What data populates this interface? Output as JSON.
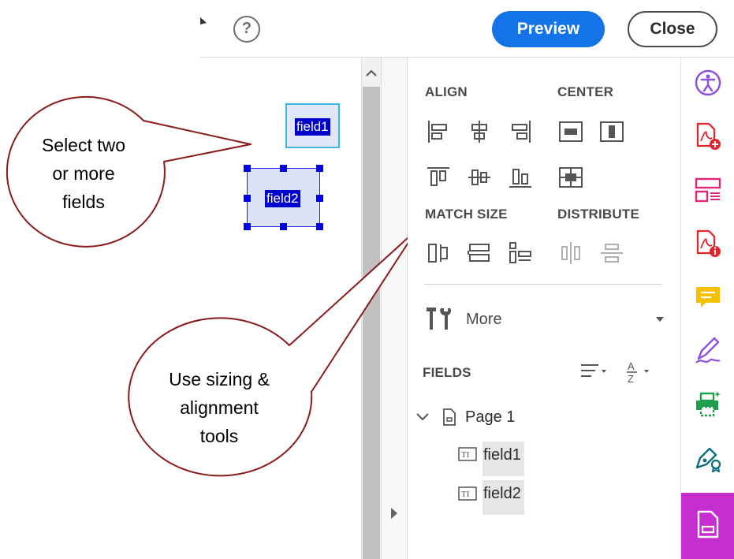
{
  "toolbar": {
    "help_label": "?",
    "preview_label": "Preview",
    "close_label": "Close"
  },
  "document": {
    "fields": [
      {
        "name": "field1",
        "selected": false
      },
      {
        "name": "field2",
        "selected": true
      }
    ],
    "callouts": [
      {
        "text_lines": [
          "Select two",
          "or more",
          "fields"
        ]
      },
      {
        "text_lines": [
          "Use sizing &",
          "alignment",
          "tools"
        ]
      }
    ]
  },
  "tools_panel": {
    "align_title": "ALIGN",
    "center_title": "CENTER",
    "match_size_title": "MATCH SIZE",
    "distribute_title": "DISTRIBUTE",
    "align_icons": [
      "align-left-icon",
      "align-center-horizontal-icon",
      "align-right-icon",
      "align-top-icon",
      "align-middle-icon",
      "align-bottom-icon"
    ],
    "center_icons": [
      "center-horizontally-icon",
      "center-vertically-icon",
      "center-both-icon"
    ],
    "match_size_icons": [
      "match-width-icon",
      "match-height-icon",
      "match-both-icon"
    ],
    "distribute_icons": [
      "distribute-vertically-icon",
      "distribute-horizontally-icon"
    ],
    "more_label": "More",
    "fields_title": "FIELDS",
    "tree": {
      "page_label": "Page 1",
      "fields": [
        "field1",
        "field2"
      ]
    }
  },
  "rail": {
    "items": [
      "accessibility-icon",
      "create-pdf-icon",
      "organize-pages-icon",
      "pdf-info-icon",
      "comment-icon",
      "fill-sign-icon",
      "print-production-icon",
      "certificates-icon",
      "prepare-form-icon"
    ],
    "active_index": 8
  },
  "colors": {
    "accent": "#1473e6",
    "rail_active": "#c62fcf",
    "callout_border": "#8b1a1a",
    "selection": "#0000ee"
  }
}
